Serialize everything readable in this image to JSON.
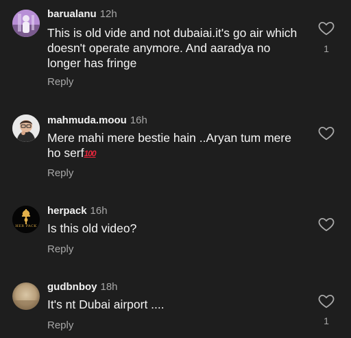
{
  "comments": [
    {
      "username": "barualanu",
      "time": "12h",
      "text": "This is old vide and not dubaiai.it's go air which doesn't operate anymore. And aaradya no longer has fringe",
      "reply": "Reply",
      "likes": "1"
    },
    {
      "username": "mahmuda.moou",
      "time": "16h",
      "text": "Mere mahi mere bestie hain ..Aryan tum mere ho serf",
      "emoji": "💯",
      "emoji_glyph": "100",
      "reply": "Reply"
    },
    {
      "username": "herpack",
      "time": "16h",
      "text": "Is this old video?",
      "reply": "Reply",
      "avatar_logo_text": "HER PACK"
    },
    {
      "username": "gudbnboy",
      "time": "18h",
      "text": "It's nt Dubai airport ....",
      "reply": "Reply",
      "likes": "1"
    }
  ],
  "icons": {
    "like": "heart-outline-icon",
    "emoji": "hundred-points-icon"
  },
  "colors": {
    "background": "#1e1e1e",
    "primary_text": "#f5f5f5",
    "secondary_text": "#a8a8a8",
    "emoji_red": "#e8263c"
  }
}
